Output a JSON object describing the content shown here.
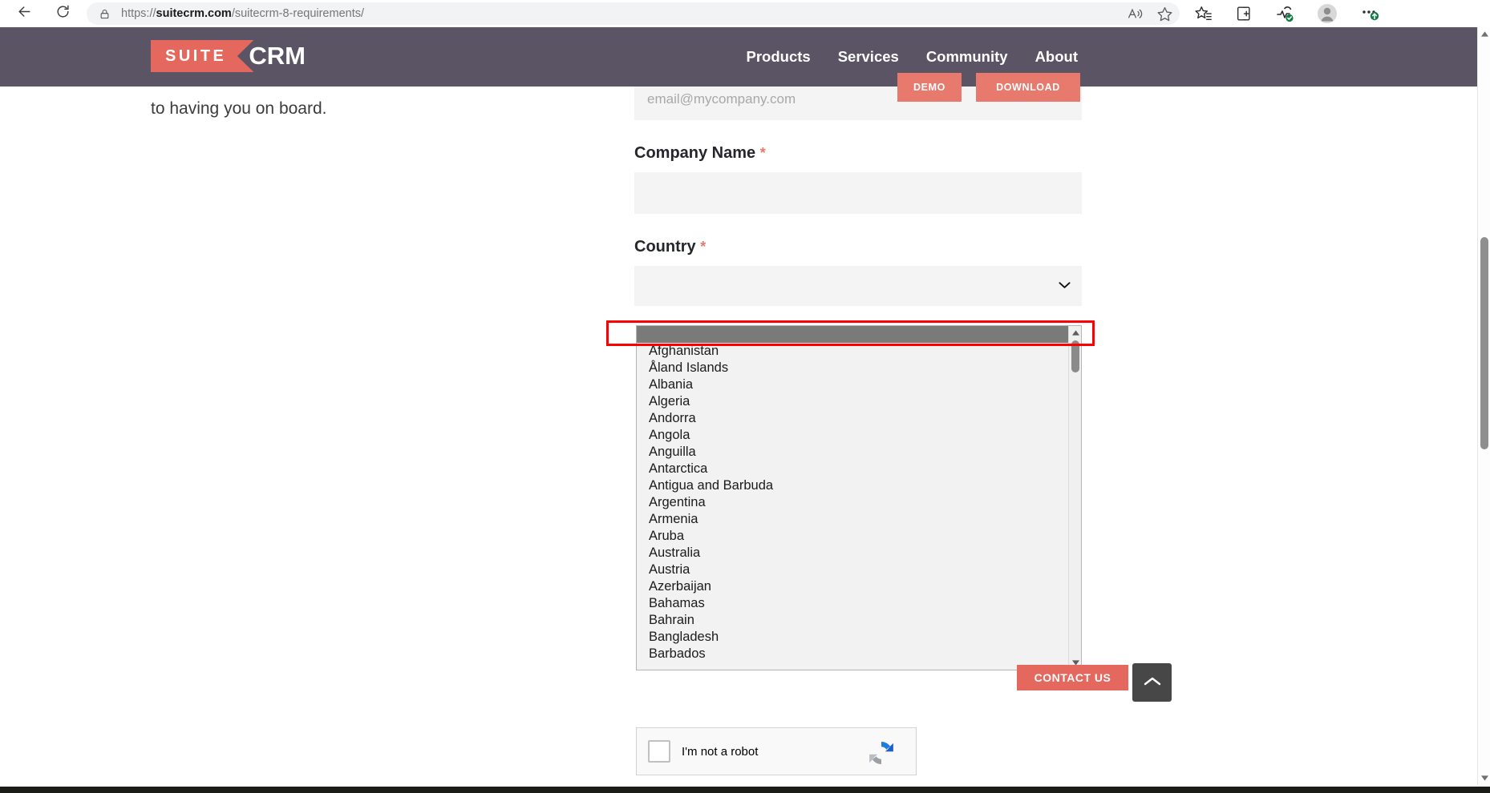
{
  "browser": {
    "url_prefix": "https://",
    "url_host": "suitecrm.com",
    "url_path": "/suitecrm-8-requirements/",
    "back_icon": "back-arrow-icon",
    "reload_icon": "reload-icon",
    "lock_icon": "lock-icon",
    "read_aloud_icon": "read-aloud-icon",
    "favorite_icon": "star-icon",
    "collections_icon": "favorites-icon",
    "split_screen_icon": "split-screen-icon",
    "browser_essentials_icon": "browser-essentials-icon",
    "profile_icon": "profile-avatar-icon",
    "settings_icon": "settings-more-icon"
  },
  "site_header": {
    "logo_suite": "SUITE",
    "logo_crm": "CRM",
    "nav": [
      {
        "label": "Products"
      },
      {
        "label": "Services"
      },
      {
        "label": "Community"
      },
      {
        "label": "About"
      }
    ],
    "demo_label": "DEMO",
    "download_label": "DOWNLOAD",
    "bg_color": "#5a5465",
    "accent_color": "#e4685d"
  },
  "page": {
    "intro_text": "to having you on board."
  },
  "form": {
    "email": {
      "placeholder": "email@mycompany.com",
      "value": ""
    },
    "company_name": {
      "label": "Company Name",
      "required_marker": "*",
      "value": ""
    },
    "country": {
      "label": "Country",
      "required_marker": "*",
      "selected_value": "",
      "chevron_icon": "chevron-down-icon",
      "options": [
        "",
        "Afghanistan",
        "Åland Islands",
        "Albania",
        "Algeria",
        "Andorra",
        "Angola",
        "Anguilla",
        "Antarctica",
        "Antigua and Barbuda",
        "Argentina",
        "Armenia",
        "Aruba",
        "Australia",
        "Austria",
        "Azerbaijan",
        "Bahamas",
        "Bahrain",
        "Bangladesh",
        "Barbados"
      ]
    }
  },
  "recaptcha": {
    "label": "I'm not a robot",
    "checkbox_checked": false
  },
  "floating": {
    "contact_us_label": "CONTACT US",
    "scroll_top_icon": "chevron-up-icon"
  },
  "annotation": {
    "highlight_color": "#ff0000"
  }
}
